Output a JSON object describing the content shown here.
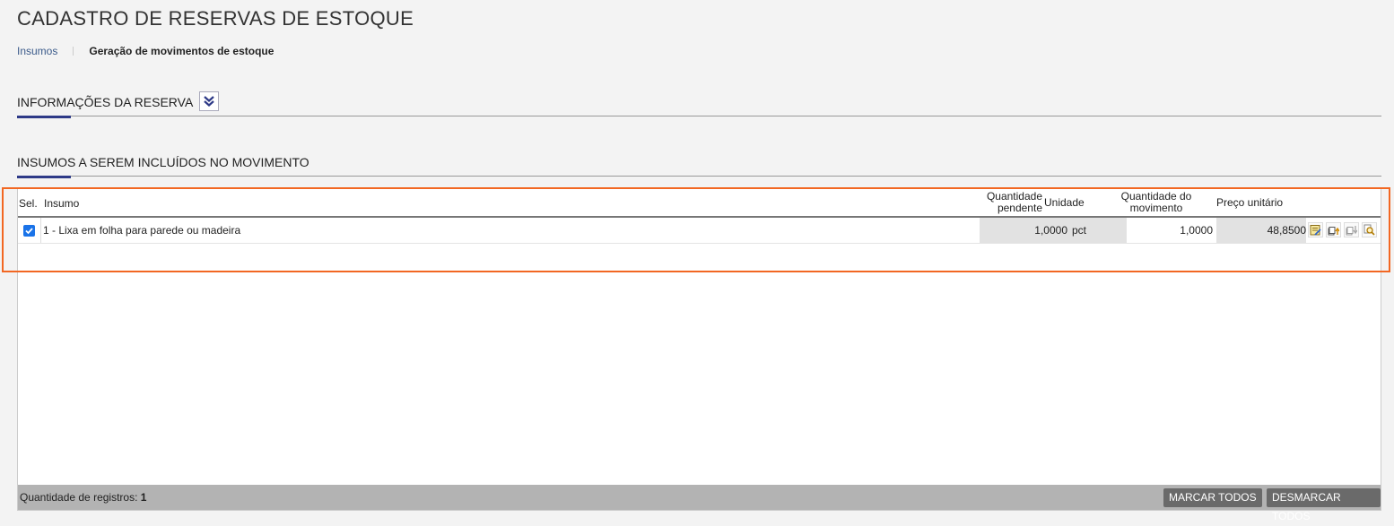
{
  "page": {
    "title": "CADASTRO DE RESERVAS DE ESTOQUE"
  },
  "breadcrumb": {
    "parent": "Insumos",
    "current": "Geração de movimentos de estoque"
  },
  "sections": {
    "reserva": {
      "label": "INFORMAÇÕES DA RESERVA",
      "toggle_icon": "double-chevron-down-icon"
    },
    "insumos": {
      "label": "INSUMOS A SEREM INCLUÍDOS NO MOVIMENTO"
    }
  },
  "grid": {
    "columns": {
      "sel": "Sel.",
      "insumo": "Insumo",
      "qtd_pendente_1": "Quantidade",
      "qtd_pendente_2": "pendente",
      "unidade": "Unidade",
      "qtd_movimento_1": "Quantidade do",
      "qtd_movimento_2": "movimento",
      "preco": "Preço unitário"
    },
    "rows": [
      {
        "selected": true,
        "insumo": "1 - Lixa em folha para parede ou madeira",
        "qtd_pendente": "1,0000",
        "unidade": "pct",
        "qtd_movimento": "1,0000",
        "preco": "48,8500",
        "actions": [
          "edit-note-icon",
          "move-up-icon",
          "move-down-icon",
          "search-icon"
        ]
      }
    ],
    "footer": {
      "records_label": "Quantidade de registros:",
      "records_count": "1",
      "mark_all": "MARCAR TODOS",
      "unmark_all": "DESMARCAR TODOS"
    }
  },
  "colors": {
    "accent": "#2e3a87",
    "highlight": "#f26722",
    "checkbox": "#1a73e8",
    "footer_button": "#6a6a6a"
  }
}
